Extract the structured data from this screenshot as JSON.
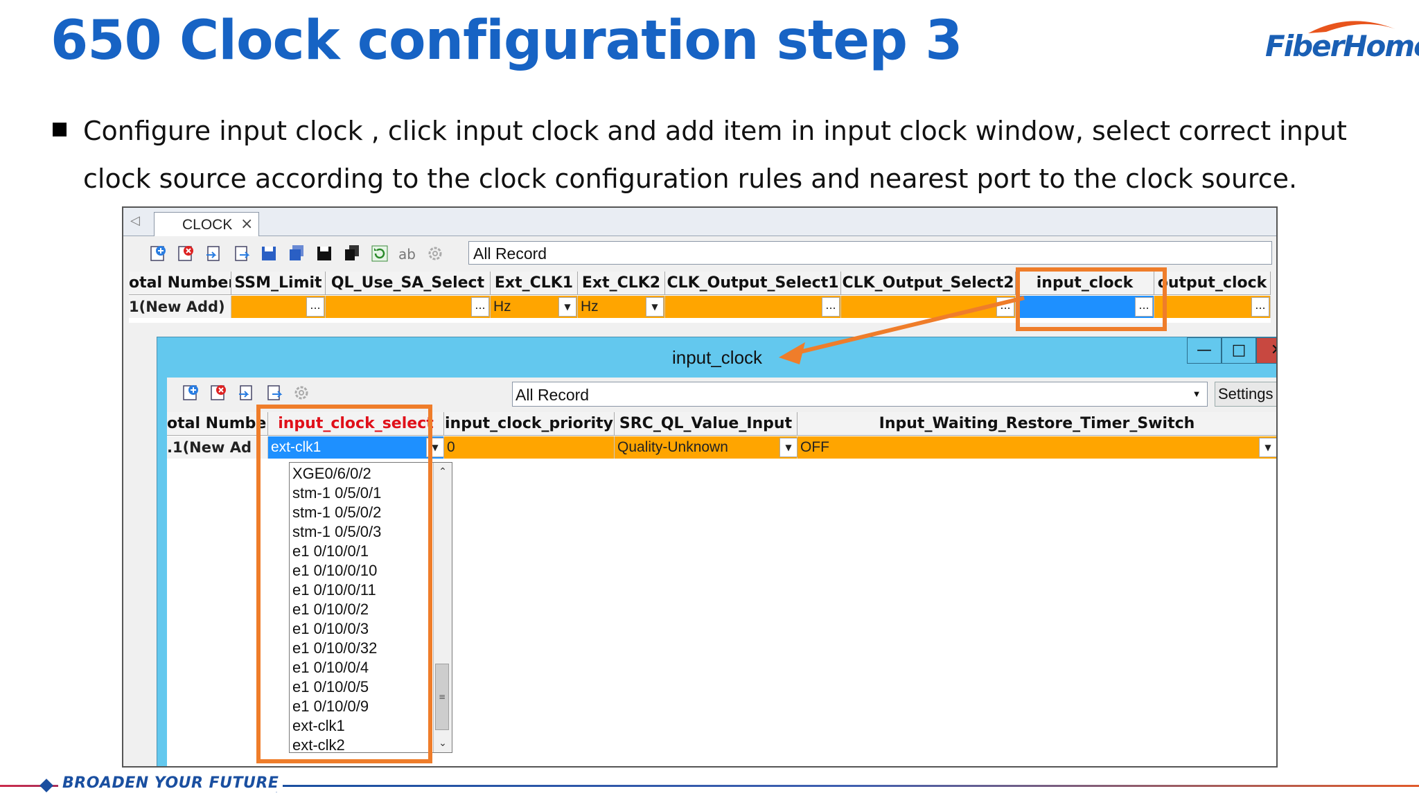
{
  "slide": {
    "title": "650 Clock configuration step 3",
    "logo_text": "FiberHome",
    "bullet": "Configure input clock , click input clock and add item in input clock window, select correct input clock source according to the clock configuration rules and nearest port to the clock source.",
    "footer": "BROADEN YOUR FUTURE"
  },
  "main_window": {
    "tab_label": "CLOCK",
    "record_filter": "All Record",
    "columns": [
      "otal Number:",
      "SSM_Limit",
      "QL_Use_SA_Select",
      "Ext_CLK1",
      "Ext_CLK2",
      "CLK_Output_Select1",
      "CLK_Output_Select2",
      "input_clock",
      "output_clock"
    ],
    "row": {
      "id": "1(New Add)",
      "ext_clk1": "Hz",
      "ext_clk2": "Hz",
      "ellipsis": "..."
    }
  },
  "sub_window": {
    "title": "input_clock",
    "record_filter": "All Record",
    "settings_label": "Settings",
    "columns": [
      "otal Numbe:",
      "input_clock_select",
      "input_clock_priority",
      "SRC_QL_Value_Input",
      "Input_Waiting_Restore_Timer_Switch"
    ],
    "row": {
      "id": ".1(New Ad",
      "input_clock_select": "ext-clk1",
      "priority": "0",
      "src_ql": "Quality-Unknown",
      "timer_switch": "OFF"
    },
    "dropdown_options": [
      "XGE0/6/0/2",
      "stm-1 0/5/0/1",
      "stm-1 0/5/0/2",
      "stm-1 0/5/0/3",
      "e1 0/10/0/1",
      "e1 0/10/0/10",
      "e1 0/10/0/11",
      "e1 0/10/0/2",
      "e1 0/10/0/3",
      "e1 0/10/0/32",
      "e1 0/10/0/4",
      "e1 0/10/0/5",
      "e1 0/10/0/9",
      "ext-clk1",
      "ext-clk2"
    ]
  },
  "colors": {
    "title_blue": "#1763c4",
    "cell_orange": "#ffa500",
    "highlight_orange": "#ef7d2a",
    "window_cyan": "#63c8ee",
    "selected_blue": "#1e90ff",
    "required_red": "#e0101a"
  },
  "icons": [
    "add-record-icon",
    "delete-record-icon",
    "import-icon",
    "export-icon",
    "save-icon",
    "save-all-icon",
    "save-as-icon",
    "copy-icon",
    "refresh-icon",
    "rename-icon",
    "settings-gear-icon"
  ]
}
